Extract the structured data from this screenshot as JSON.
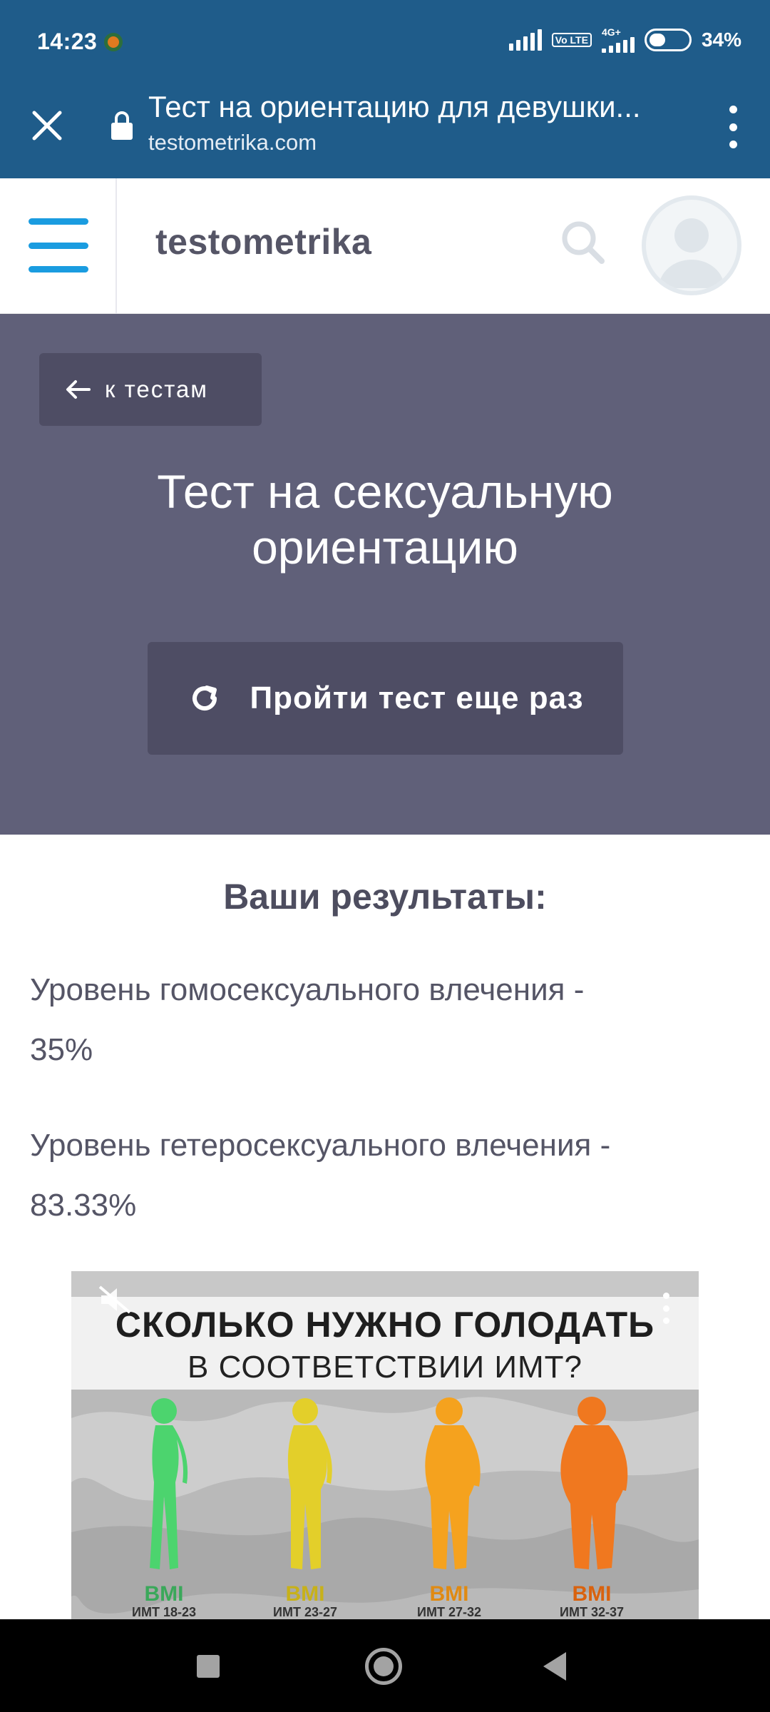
{
  "status_bar": {
    "time": "14:23",
    "volte": "Vo LTE",
    "network": "4G+",
    "battery": "34%"
  },
  "browser": {
    "page_title": "Тест на ориентацию для девушки...",
    "url": "testometrika.com"
  },
  "site_header": {
    "logo": "testometrika"
  },
  "hero": {
    "back_label": "к тестам",
    "title_line1": "Тест на сексуальную",
    "title_line2": "ориентацию",
    "retake_label": "Пройти тест еще раз"
  },
  "results": {
    "heading": "Ваши результаты:",
    "homo_label": "Уровень гомосексуального влечения -",
    "homo_value": "35%",
    "hetero_label": "Уровень гетеросексуального влечения -",
    "hetero_value": "83.33%"
  },
  "ad": {
    "line1": "СКОЛЬКО НУЖНО ГОЛОДАТЬ",
    "line2": "В СООТВЕТСТВИИ ИМТ?",
    "figures": [
      {
        "bmi": "BMI",
        "imt": "ИМТ 18-23",
        "color": "#4cd46e"
      },
      {
        "bmi": "BMI",
        "imt": "ИМТ 23-27",
        "color": "#e3cf2a"
      },
      {
        "bmi": "BMI",
        "imt": "ИМТ 27-32",
        "color": "#f5a21e"
      },
      {
        "bmi": "BMI",
        "imt": "ИМТ 32-37",
        "color": "#f0781f"
      }
    ]
  },
  "colors": {
    "status_bar": "#1f5c8a",
    "hero_bg": "#606079",
    "button_bg": "#4e4d64",
    "menu_accent": "#1a9ce0"
  }
}
